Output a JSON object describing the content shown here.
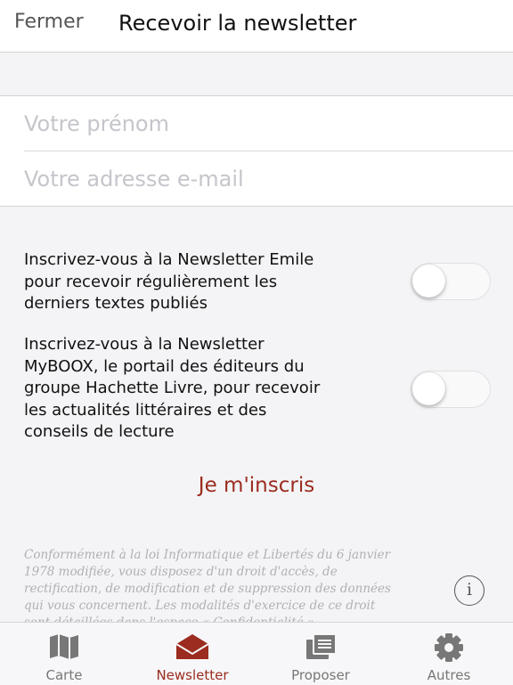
{
  "header": {
    "close_label": "Fermer",
    "title": "Recevoir la newsletter"
  },
  "form": {
    "first_name": {
      "value": "",
      "placeholder": "Votre prénom"
    },
    "email": {
      "value": "",
      "placeholder": "Votre adresse e-mail"
    }
  },
  "options": [
    {
      "lines": [
        "Inscrivez-vous à la Newsletter Emile",
        "pour recevoir régulièrement les",
        "derniers textes publiés"
      ],
      "enabled": false
    },
    {
      "lines": [
        "Inscrivez-vous à la Newsletter",
        "MyBOOX, le portail des éditeurs du",
        "groupe Hachette Livre, pour recevoir",
        "les actualités littéraires et des",
        "conseils de lecture"
      ],
      "enabled": false
    }
  ],
  "submit_label": "Je m'inscris",
  "legal": {
    "lines": [
      "Conformément à la loi Informatique et Libertés du 6 janvier",
      "1978 modifiée, vous disposez d'un droit d'accès, de",
      "rectification, de modification et de suppression des données",
      "qui vous concernent. Les modalités d'exercice de ce droit",
      "sont détaillées dans l'espace « Confidentialité »"
    ],
    "info_icon": "info-circle-icon",
    "info_glyph": "i"
  },
  "tabbar": {
    "tabs": [
      {
        "label": "Carte",
        "icon": "map-icon",
        "active": false
      },
      {
        "label": "Newsletter",
        "icon": "envelope-icon",
        "active": true
      },
      {
        "label": "Proposer",
        "icon": "documents-icon",
        "active": false
      },
      {
        "label": "Autres",
        "icon": "gear-icon",
        "active": false
      }
    ]
  },
  "colors": {
    "accent": "#9b2c1f",
    "inactive_tab": "#777777",
    "background": "#f4f4f6",
    "placeholder": "#c5c5cb"
  }
}
